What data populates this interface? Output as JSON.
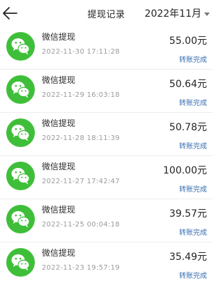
{
  "header": {
    "title": "提现记录",
    "month": "2022年11月"
  },
  "colors": {
    "wechat_green": "#3fbf39",
    "status_blue": "#3b6fb4",
    "time_gray": "#9a9a9a"
  },
  "icons": {
    "back": "back-arrow-icon",
    "avatar": "wechat-icon",
    "dropdown": "caret-down-icon"
  },
  "records": [
    {
      "title": "微信提现",
      "time": "2022-11-30 17:11:28",
      "amount": "55.00元",
      "status": "转账完成"
    },
    {
      "title": "微信提现",
      "time": "2022-11-29 16:03:18",
      "amount": "50.64元",
      "status": "转账完成"
    },
    {
      "title": "微信提现",
      "time": "2022-11-28 18:11:39",
      "amount": "50.78元",
      "status": "转账完成"
    },
    {
      "title": "微信提现",
      "time": "2022-11-27 17:42:47",
      "amount": "100.00元",
      "status": "转账完成"
    },
    {
      "title": "微信提现",
      "time": "2022-11-25 00:04:18",
      "amount": "39.57元",
      "status": "转账完成"
    },
    {
      "title": "微信提现",
      "time": "2022-11-23 19:57:19",
      "amount": "35.49元",
      "status": "转账完成"
    }
  ]
}
